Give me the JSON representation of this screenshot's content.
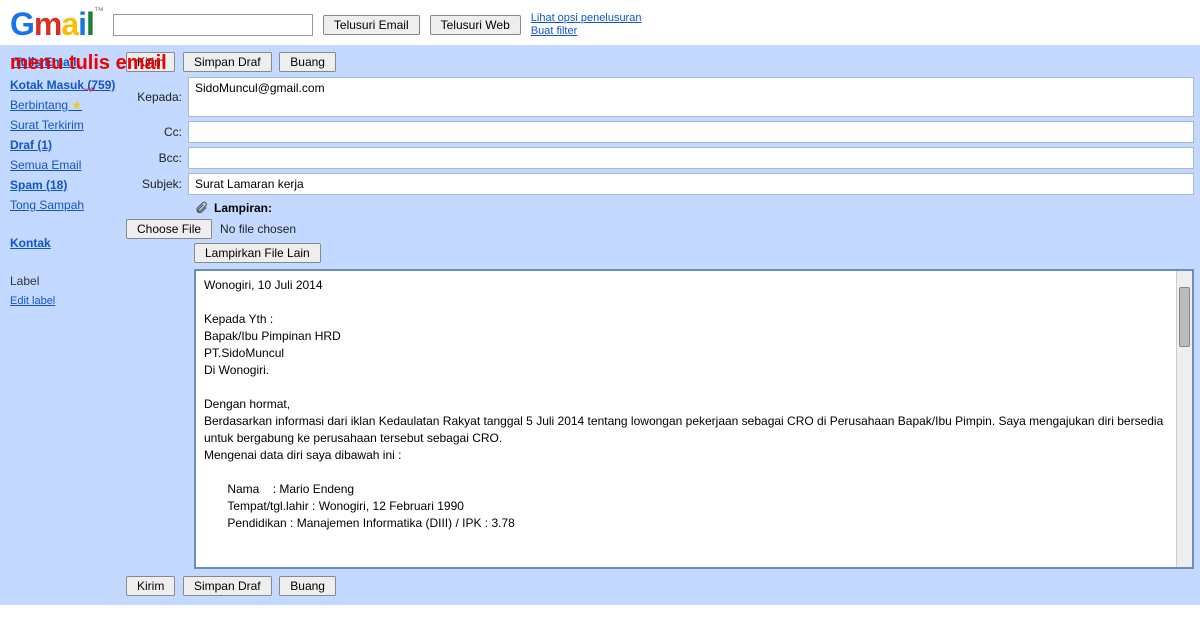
{
  "header": {
    "logo_text": "Gmail",
    "search_value": "",
    "btn_email": "Telusuri Email",
    "btn_web": "Telusuri Web",
    "link_opsi": "Lihat opsi penelusuran",
    "link_filter": "Buat filter"
  },
  "annotation": "menu tulis email",
  "sidebar": {
    "compose": "Tulis Email",
    "inbox": "Kotak Masuk (759)",
    "starred": "Berbintang",
    "sent": "Surat Terkirim",
    "drafts": "Draf (1)",
    "all": "Semua Email",
    "spam": "Spam (18)",
    "trash": "Tong Sampah",
    "contacts": "Kontak",
    "label_hdr": "Label",
    "edit_label": "Edit label"
  },
  "toolbar": {
    "send": "Kirim",
    "save": "Simpan Draf",
    "discard": "Buang"
  },
  "fields": {
    "to_label": "Kepada:",
    "to_value": "SidoMuncul@gmail.com",
    "cc_label": "Cc:",
    "cc_value": "",
    "bcc_label": "Bcc:",
    "bcc_value": "",
    "subject_label": "Subjek:",
    "subject_value": "Surat Lamaran kerja"
  },
  "attach": {
    "label": "Lampiran:",
    "choose_file": "Choose File",
    "no_file": "No file chosen",
    "more": "Lampirkan File Lain"
  },
  "body_text": "Wonogiri, 10 Juli 2014\n\nKepada Yth :\nBapak/Ibu Pimpinan HRD\nPT.SidoMuncul\nDi Wonogiri.\n\nDengan hormat,\nBerdasarkan informasi dari iklan Kedaulatan Rakyat tanggal 5 Juli 2014 tentang lowongan pekerjaan sebagai CRO di Perusahaan Bapak/Ibu Pimpin. Saya mengajukan diri bersedia untuk bergabung ke perusahaan tersebut sebagai CRO.\nMengenai data diri saya dibawah ini :\n\n       Nama    : Mario Endeng\n       Tempat/tgl.lahir : Wonogiri, 12 Februari 1990\n       Pendidikan : Manajemen Informatika (DIII) / IPK : 3.78"
}
